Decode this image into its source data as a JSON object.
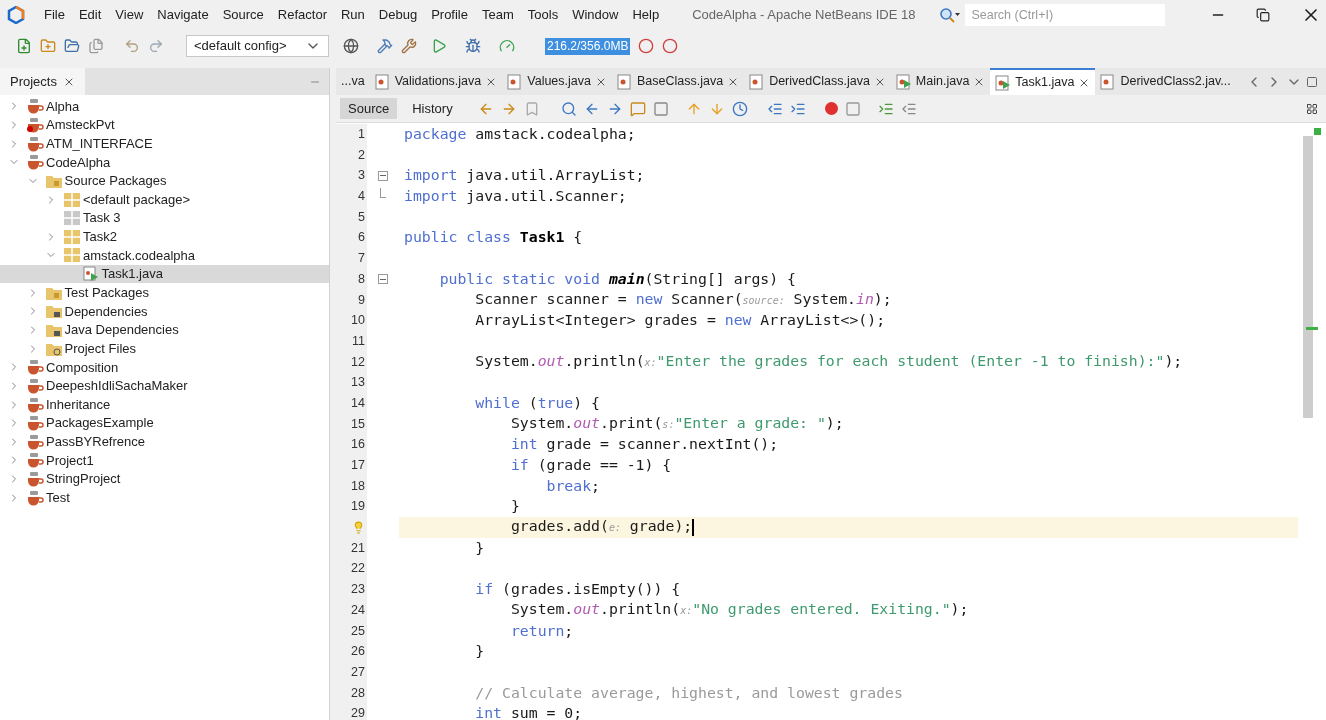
{
  "window": {
    "title": "CodeAlpha - Apache NetBeans IDE 18"
  },
  "menu": [
    "File",
    "Edit",
    "View",
    "Navigate",
    "Source",
    "Refactor",
    "Run",
    "Debug",
    "Profile",
    "Team",
    "Tools",
    "Window",
    "Help"
  ],
  "search": {
    "placeholder": "Search (Ctrl+I)"
  },
  "toolbar": {
    "config": "<default config>",
    "memory": "216.2/356.0MB"
  },
  "projects_panel": {
    "title": "Projects",
    "tree": [
      {
        "label": "Alpha",
        "kind": "project",
        "expanded": false,
        "selected": false
      },
      {
        "label": "AmsteckPvt",
        "kind": "project-error",
        "expanded": false,
        "selected": false
      },
      {
        "label": "ATM_INTERFACE",
        "kind": "project",
        "expanded": false,
        "selected": false
      },
      {
        "label": "CodeAlpha",
        "kind": "project",
        "expanded": true,
        "selected": false,
        "children": [
          {
            "label": "Source Packages",
            "kind": "folder",
            "expanded": true,
            "selected": false,
            "children": [
              {
                "label": "<default package>",
                "kind": "package",
                "expanded": false,
                "selected": false
              },
              {
                "label": "Task 3",
                "kind": "package-empty",
                "selected": false
              },
              {
                "label": "Task2",
                "kind": "package",
                "expanded": false,
                "selected": false
              },
              {
                "label": "amstack.codealpha",
                "kind": "package",
                "expanded": true,
                "selected": false,
                "children": [
                  {
                    "label": "Task1.java",
                    "kind": "java",
                    "selected": true
                  }
                ]
              }
            ]
          },
          {
            "label": "Test Packages",
            "kind": "folder",
            "expanded": false,
            "selected": false
          },
          {
            "label": "Dependencies",
            "kind": "library",
            "expanded": false,
            "selected": false
          },
          {
            "label": "Java Dependencies",
            "kind": "library",
            "expanded": false,
            "selected": false
          },
          {
            "label": "Project Files",
            "kind": "config",
            "expanded": false,
            "selected": false
          }
        ]
      },
      {
        "label": "Composition",
        "kind": "project",
        "expanded": false,
        "selected": false
      },
      {
        "label": "DeepeshIdliSachaMaker",
        "kind": "project",
        "expanded": false,
        "selected": false
      },
      {
        "label": "Inheritance",
        "kind": "project",
        "expanded": false,
        "selected": false
      },
      {
        "label": "PackagesExample",
        "kind": "project",
        "expanded": false,
        "selected": false
      },
      {
        "label": "PassBYRefrence",
        "kind": "project",
        "expanded": false,
        "selected": false
      },
      {
        "label": "Project1",
        "kind": "project",
        "expanded": false,
        "selected": false
      },
      {
        "label": "StringProject",
        "kind": "project",
        "expanded": false,
        "selected": false
      },
      {
        "label": "Test",
        "kind": "project",
        "expanded": false,
        "selected": false
      }
    ]
  },
  "editor_tabs": [
    {
      "label": "...va",
      "kind": "none",
      "closable": false,
      "selected": false
    },
    {
      "label": "Validations.java",
      "kind": "class",
      "closable": true,
      "selected": false
    },
    {
      "label": "Values.java",
      "kind": "class",
      "closable": true,
      "selected": false
    },
    {
      "label": "BaseClass.java",
      "kind": "class",
      "closable": true,
      "selected": false
    },
    {
      "label": "DerivedClass.java",
      "kind": "class",
      "closable": true,
      "selected": false
    },
    {
      "label": "Main.java",
      "kind": "main",
      "closable": true,
      "selected": false
    },
    {
      "label": "Task1.java",
      "kind": "main",
      "closable": true,
      "selected": true
    },
    {
      "label": "DerivedClass2.jav...",
      "kind": "class",
      "closable": false,
      "selected": false
    }
  ],
  "view_tabs": [
    {
      "label": "Source",
      "selected": true
    },
    {
      "label": "History",
      "selected": false
    }
  ],
  "code": [
    {
      "number": "1",
      "current": false,
      "tokens": [
        {
          "kind": "keyword",
          "t": "package"
        },
        {
          "kind": "plain",
          "t": " amstack.codealpha;"
        }
      ]
    },
    {
      "number": "2",
      "current": false
    },
    {
      "number": "3",
      "current": false,
      "expanded": true,
      "tokens": [
        {
          "kind": "keyword",
          "t": "import"
        },
        {
          "kind": "plain",
          "t": " java.util.ArrayList;"
        }
      ]
    },
    {
      "number": "4",
      "current": false,
      "fold_end": true,
      "tokens": [
        {
          "kind": "keyword",
          "t": "import"
        },
        {
          "kind": "plain",
          "t": " java.util.Scanner;"
        }
      ]
    },
    {
      "number": "5",
      "current": false
    },
    {
      "number": "6",
      "current": false,
      "tokens": [
        {
          "kind": "keyword",
          "t": "public class"
        },
        {
          "kind": "bold",
          "t": " Task1"
        },
        {
          "kind": "plain",
          "t": " {"
        }
      ]
    },
    {
      "number": "7",
      "current": false
    },
    {
      "number": "8",
      "current": false,
      "expanded": true,
      "tokens": [
        {
          "kind": "keyword",
          "t": "    public static void"
        },
        {
          "kind": "bold-italic",
          "t": " main"
        },
        {
          "kind": "plain",
          "t": "(String[] args) {"
        }
      ]
    },
    {
      "number": "9",
      "current": false,
      "tokens": [
        {
          "kind": "plain",
          "t": "        Scanner scanner = "
        },
        {
          "kind": "keyword",
          "t": "new"
        },
        {
          "kind": "plain",
          "t": " Scanner("
        },
        {
          "kind": "hint",
          "t": "source:"
        },
        {
          "kind": "plain",
          "t": " System."
        },
        {
          "kind": "field",
          "t": "in"
        },
        {
          "kind": "plain",
          "t": ");"
        }
      ]
    },
    {
      "number": "10",
      "current": false,
      "tokens": [
        {
          "kind": "plain",
          "t": "        ArrayList<Integer> grades = "
        },
        {
          "kind": "keyword",
          "t": "new"
        },
        {
          "kind": "plain",
          "t": " ArrayList<>();"
        }
      ]
    },
    {
      "number": "11",
      "current": false
    },
    {
      "number": "12",
      "current": false,
      "tokens": [
        {
          "kind": "plain",
          "t": "        System."
        },
        {
          "kind": "field",
          "t": "out"
        },
        {
          "kind": "plain",
          "t": ".println("
        },
        {
          "kind": "hint",
          "t": "x:"
        },
        {
          "kind": "string",
          "t": "\"Enter the grades for each student (Enter -1 to finish):\""
        },
        {
          "kind": "plain",
          "t": ");"
        }
      ]
    },
    {
      "number": "13",
      "current": false
    },
    {
      "number": "14",
      "current": false,
      "tokens": [
        {
          "kind": "keyword",
          "t": "        while"
        },
        {
          "kind": "plain",
          "t": " ("
        },
        {
          "kind": "keyword",
          "t": "true"
        },
        {
          "kind": "plain",
          "t": ") {"
        }
      ]
    },
    {
      "number": "15",
      "current": false,
      "tokens": [
        {
          "kind": "plain",
          "t": "            System."
        },
        {
          "kind": "field",
          "t": "out"
        },
        {
          "kind": "plain",
          "t": ".print("
        },
        {
          "kind": "hint",
          "t": "s:"
        },
        {
          "kind": "string",
          "t": "\"Enter a grade: \""
        },
        {
          "kind": "plain",
          "t": ");"
        }
      ]
    },
    {
      "number": "16",
      "current": false,
      "tokens": [
        {
          "kind": "keyword",
          "t": "            int"
        },
        {
          "kind": "plain",
          "t": " grade = scanner.nextInt();"
        }
      ]
    },
    {
      "number": "17",
      "current": false,
      "tokens": [
        {
          "kind": "keyword",
          "t": "            if"
        },
        {
          "kind": "plain",
          "t": " (grade == -1) {"
        }
      ]
    },
    {
      "number": "18",
      "current": false,
      "tokens": [
        {
          "kind": "keyword",
          "t": "                break"
        },
        {
          "kind": "plain",
          "t": ";"
        }
      ]
    },
    {
      "number": "19",
      "current": false,
      "tokens": [
        {
          "kind": "plain",
          "t": "            }"
        }
      ]
    },
    {
      "bulb": true,
      "current": true,
      "tokens": [
        {
          "kind": "plain",
          "t": "            grades.add("
        },
        {
          "kind": "hint",
          "t": "e:"
        },
        {
          "kind": "plain",
          "t": " grade);"
        }
      ]
    },
    {
      "number": "21",
      "current": false,
      "tokens": [
        {
          "kind": "plain",
          "t": "        }"
        }
      ]
    },
    {
      "number": "22",
      "current": false
    },
    {
      "number": "23",
      "current": false,
      "tokens": [
        {
          "kind": "keyword",
          "t": "        if"
        },
        {
          "kind": "plain",
          "t": " (grades.isEmpty()) {"
        }
      ]
    },
    {
      "number": "24",
      "current": false,
      "tokens": [
        {
          "kind": "plain",
          "t": "            System."
        },
        {
          "kind": "field",
          "t": "out"
        },
        {
          "kind": "plain",
          "t": ".println("
        },
        {
          "kind": "hint",
          "t": "x:"
        },
        {
          "kind": "string",
          "t": "\"No grades entered. Exiting.\""
        },
        {
          "kind": "plain",
          "t": ");"
        }
      ]
    },
    {
      "number": "25",
      "current": false,
      "tokens": [
        {
          "kind": "keyword",
          "t": "            return"
        },
        {
          "kind": "plain",
          "t": ";"
        }
      ]
    },
    {
      "number": "26",
      "current": false,
      "tokens": [
        {
          "kind": "plain",
          "t": "        }"
        }
      ]
    },
    {
      "number": "27",
      "current": false
    },
    {
      "number": "28",
      "current": false,
      "tokens": [
        {
          "kind": "comment",
          "t": "        // Calculate average, highest, and lowest grades"
        }
      ]
    },
    {
      "number": "29",
      "current": false,
      "tokens": [
        {
          "kind": "keyword",
          "t": "        int"
        },
        {
          "kind": "plain",
          "t": " sum = 0;"
        }
      ]
    }
  ]
}
